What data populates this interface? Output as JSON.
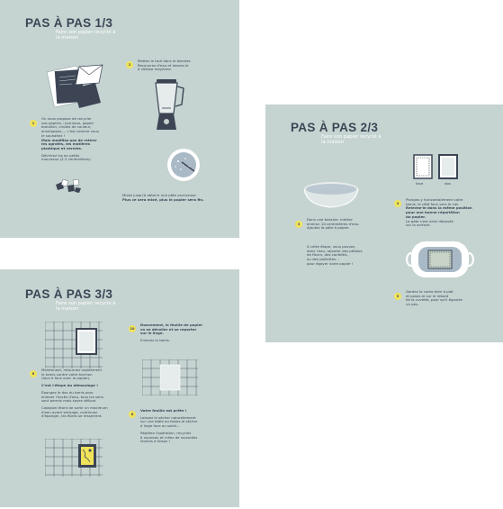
{
  "colors": {
    "background": "#c5d3d1",
    "title": "#3d4555",
    "subtitle": "#ffffff",
    "badge": "#f0e35a",
    "text": "#3d4555"
  },
  "card1": {
    "title": "PAS À PAS 1/3",
    "subtitle": "Faire son papier recyclé à la maison",
    "step1": {
      "badge": "1",
      "lines": [
        "On vous propose de recycler",
        "vos papiers : journaux, papier",
        "brouillon, chutes de couleur,",
        "enveloppes,... c'est comme vous",
        "le souhaitez !"
      ],
      "bold_lines": [
        "Mais modifiez pas de retirer",
        "les agrafes, les matières",
        "plastique et vernies."
      ],
      "lines2": [
        "Déchirez les en petits",
        "morceaux (2-3 centimètres)."
      ]
    },
    "step2": {
      "badge": "2",
      "lines": [
        "Mettez le tout dans le blender.",
        "Recouvrez d'eau et laissez-le",
        "à vitesse moyenne."
      ]
    },
    "step3": {
      "line1": "Mixez jusqu'à obtenir une pâte onctueuse.",
      "line2": "Plus ce sera mixé, plus le papier sera fin."
    }
  },
  "card2": {
    "title": "PAS À PAS 2/3",
    "subtitle": "Faire son papier recyclé à la maison",
    "frame_labels": [
      "face",
      "dos"
    ],
    "step3": {
      "badge": "3",
      "lines": [
        "Dans une bassine, mettez",
        "environ 10 centimètres d'eau.",
        "Ajoutez la pâte à papier."
      ],
      "lines2": [
        "À cette étape, vous pouvez,",
        "dans l'eau, rajouter des pétales",
        "de fleurs, des confettis,",
        "ou des paillettes...",
        "pour égayer votre papier !"
      ]
    },
    "step4": {
      "badge": "4",
      "lines": [
        "Plongez-y horizontalement votre",
        "tamis, le côté face vers le ciel."
      ],
      "bold_lines": [
        "Relevez-le dans la même position",
        "pour une bonne répartition",
        "du papier."
      ],
      "lines2": [
        "La pâte s'est ainsi déposée",
        "sur la surface."
      ]
    },
    "step5": {
      "badge": "5",
      "lines": [
        "Gardez le cadre bien à plat",
        "et posez-le sur le rebord",
        "de la cuvette, pour qu'il égoutte",
        "un peu."
      ]
    }
  },
  "card3": {
    "title": "PAS À PAS 3/3",
    "subtitle": "Faire son papier recyclé à la maison",
    "step6": {
      "badge": "6",
      "lines": [
        "Maintenant, retournez rapidement",
        "le tamis contre votre torchon",
        "(face à face avec le papier)."
      ],
      "bold_line": "C'est l'étape du démoulage !",
      "lines2": [
        "Épongez le dos du tamis pour",
        "enlever l'excès d'eau, tous les sens",
        "sont permis mais soyez délicat."
      ],
      "lines3": [
        "Colapsiel étant de sortir un maximum",
        "d'eau avant séchage, continuez",
        "d'éponger, les fibres se resserrent."
      ]
    },
    "step7": {
      "badge": "10",
      "bold_lines": [
        "Doucement, la feuille de papier",
        "va se décoller et se reporter",
        "sur le linge."
      ],
      "line": "Enlevez le tamis."
    },
    "step8": {
      "badge": "8",
      "bold_line": "Votre feuille est prête !",
      "lines": [
        "Laissez le sécher naturellement",
        "sur une table ou faisez-le sécher",
        "à linge face au soleil..."
      ],
      "lines2": [
        "Répétez l'opération, recyclez",
        "à nouveau et créez de nouvelles",
        "feuilles à foison !"
      ]
    }
  }
}
